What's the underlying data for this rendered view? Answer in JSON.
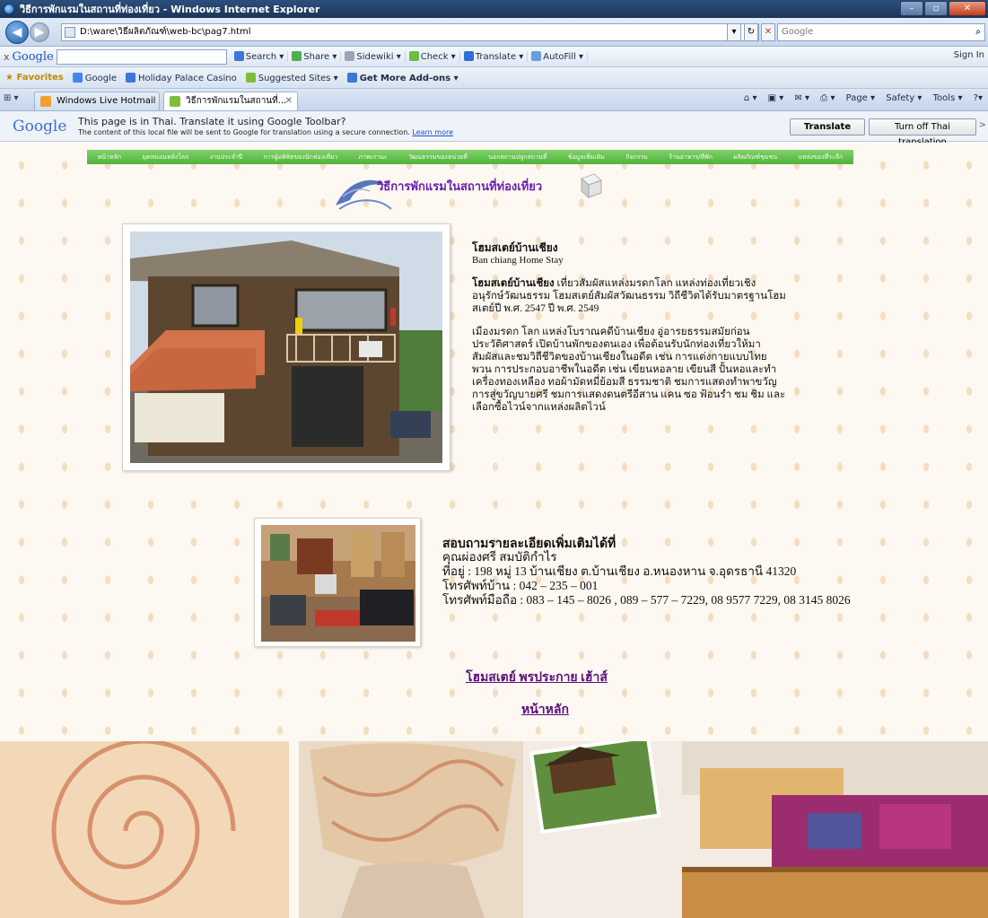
{
  "window": {
    "title": "วิธีการพักแรมในสถานที่ท่องเที่ยว - Windows Internet Explorer",
    "minimize": "–",
    "maximize": "▫",
    "close": "✕"
  },
  "addressbar": {
    "url": "D:\\ware\\วิธีผลิตภัณฑ์\\web-bc\\pag7.html",
    "refresh": "↻",
    "stop": "✕",
    "search_placeholder": "Google",
    "search_go": "⌕"
  },
  "google_toolbar": {
    "close": "x",
    "logo": "Google",
    "items": [
      "Search",
      "Share",
      "Sidewiki",
      "Check",
      "Translate",
      "AutoFill"
    ],
    "sign_in": "Sign In"
  },
  "favorites_bar": {
    "favorites": "Favorites",
    "items": [
      "Google",
      "Holiday Palace Casino",
      "Suggested Sites ▾",
      "Get More Add-ons ▾"
    ]
  },
  "tabs": {
    "quick_tabs": "⊞ ▾",
    "items": [
      {
        "label": "Windows Live Hotmail"
      },
      {
        "label": "วิธีการพักแรมในสถานที่..."
      }
    ],
    "close": "✕",
    "command_bar": [
      "Page ▾",
      "Safety ▾",
      "Tools ▾",
      "?▾"
    ]
  },
  "infobar": {
    "logo": "Google",
    "line1": "This page is in Thai.  Translate it using Google Toolbar?",
    "line2": "The content of this local file will be sent to Google for translation using a secure connection.",
    "learn_more": "Learn more",
    "translate_button": "Translate",
    "turnoff_button": "Turn off Thai translation",
    "more": ">"
  },
  "page": {
    "nav_items": [
      "หน้าหลัก",
      "มุดหมอนหลังโลก",
      "งานประจำปี",
      "การผู้อพิพิธของนักท่องเที่ยว",
      "ภาพเก่านะ",
      "วัฒนธรรมของหน่วยที่",
      "นอกสถานปลูกสถานที่",
      "ข้อมูลเพิ่มเติม",
      "กิจกรรม",
      "ร้านอาหาร/ที่พัก",
      "ผลิตภัณฑ์ชุมชน",
      "แหล่งของที่ระลึก"
    ],
    "banner_title": "วิธีการพักแรมในสถานที่ท่องเที่ยว",
    "intro": {
      "heading": "โฮมสเตย์บ้านเชียง",
      "subheading": "Ban chiang Home Stay",
      "p1_bold": "โฮมสเตย์บ้านเชียง",
      "p1_rest": " เที่ยวสัมผัสแหล่งมรดกโลก แหล่งท่องเที่ยวเชิงอนุรักษ์วัฒนธรรม โฮมสเตย์สัมผัสวัฒนธรรม วิถีชีวิตได้รับมาตรฐานโฮมสเตย์ปี พ.ศ. 2547 ปี พ.ศ. 2549",
      "p2": "เมืองมรดก โลก แหล่งโบราณคดีบ้านเชียง อู่อารยธรรมสมัยก่อนประวัติศาสตร์ เปิดบ้านพักของตนเอง เพื่อต้อนรับนักท่องเที่ยวให้มาสัมผัสและชมวิถีชีวิตของบ้านเชียงในอดีต เช่น การแต่งกายแบบไทยพวน การประกอบอาชีพในอดีต เช่น เขียนหอลาย เขียนสี ปั้นหอและทำเครื่องทองเหลือง ทอผ้ามัดหมี่ย้อมสี ธรรมชาติ ชมการแสดงทำพาขวัญ การสู่ขวัญบายศรี ชมการแสดงดนตรีอีสาน แคน ซอ ฟ้อนรำ ชม ชิม และเลือกซื้อไวน์จากแหล่งผลิตไวน์"
    },
    "contact": {
      "heading": "สอบถามรายละเอียดเพิ่มเติมได้ที่",
      "name": "คุณผ่องศรี สมบัติกำไร",
      "address": "ที่อยู่ : 198 หมู่ 13 บ้านเชียง ต.บ้านเชียง อ.หนองหาน จ.อุดรธานี 41320",
      "home_phone": "โทรศัพท์บ้าน : 042 – 235 – 001",
      "mobile": "โทรศัพท์มือถือ : 083 – 145 – 8026 , 089 – 577 – 7229, 08 9577 7229, 08 3145 8026"
    },
    "links": {
      "homestay": "โฮมสเตย์ พรประกาย เฮ้าส์",
      "home": "หน้าหลัก"
    }
  },
  "colors": {
    "nav_green": "#5cbf45",
    "banner_purple": "#6a1fae",
    "link_purple": "#5a0f7d",
    "page_bg": "#fdf8f1"
  }
}
